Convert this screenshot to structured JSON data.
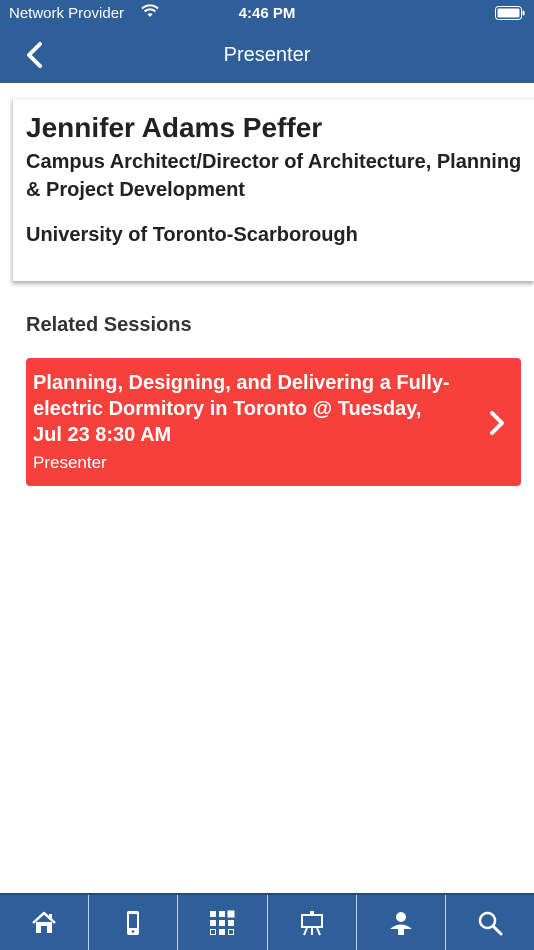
{
  "status_bar": {
    "carrier": "Network Provider",
    "time": "4:46 PM"
  },
  "nav": {
    "title": "Presenter",
    "back_icon": "chevron-left-icon"
  },
  "presenter": {
    "name": "Jennifer Adams Peffer",
    "title": "Campus Architect/Director of Architecture, Planning & Project Development",
    "organization": "University of Toronto-Scarborough"
  },
  "related_sessions": {
    "heading": "Related Sessions",
    "items": [
      {
        "title": "Planning, Designing, and Delivering a Fully-electric Dormitory in Toronto @ Tuesday, Jul 23 8:30 AM",
        "role": "Presenter"
      }
    ]
  },
  "tab_bar": {
    "tabs": [
      "home-icon",
      "mobile-device-icon",
      "grid-icon",
      "presentation-board-icon",
      "speaker-icon",
      "search-icon"
    ]
  },
  "colors": {
    "header": "#2f5f98",
    "session_card": "#f5403b",
    "text": "#222222"
  }
}
